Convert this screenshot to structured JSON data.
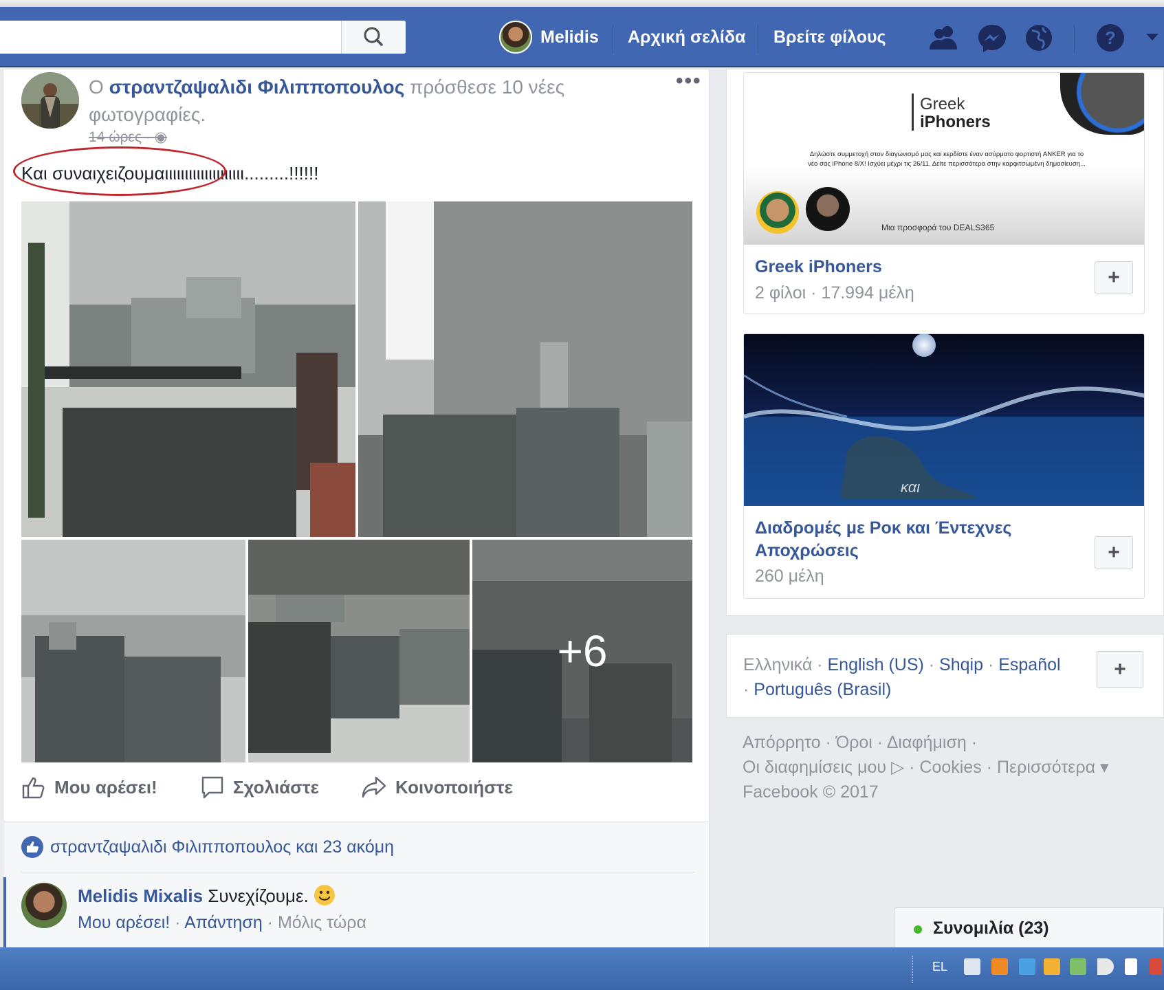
{
  "topbar": {
    "search_placeholder": "",
    "user": "Melidis",
    "home": "Αρχική σελίδα",
    "find_friends": "Βρείτε φίλους"
  },
  "post": {
    "author_prefix": "Ο ",
    "author": "στραντζαψαλιδι Φιλιπποπουλος",
    "action": " πρόσθεσε 10 νέες φωτογραφίες.",
    "meta": "14 ώρες · ",
    "more": "•••",
    "text": "Και συναιχειζουμαιιιιιιιιιιιιιιιιιιιι.........!!!!!!",
    "more_photos": "+6",
    "like": "Μου αρέσει!",
    "comment": "Σχολιάστε",
    "share": "Κοινοποιήστε",
    "likes_line": "στραντζαψαλιδι Φιλιπποπουλος και 23 ακόμη",
    "commenter": "Melidis Mixalis",
    "comment_text": " Συνεχίζουμε. ",
    "comment_like": "Μου αρέσει!",
    "comment_reply": "Απάντηση",
    "comment_time": " · Μόλις τώρα"
  },
  "groups": [
    {
      "name": "Greek iPhoners",
      "members": "2 φίλοι · 17.994 μέλη",
      "banner_title1": "Greek",
      "banner_title2": "iPhoners",
      "banner_text": "Δηλώστε συμμετοχή στον διαγωνισμό μας και κερδίστε έναν ασύρματο φορτιστή ANKER για το νέο σας iPhone 8/X! Ισχύει μέχρι τις 26/11. Δείτε περισσότερα στην καρφιτσωμένη δημοσίευση...",
      "banner_footer": "Μια προσφορά του DEALS365"
    },
    {
      "name": "Διαδρομές με Ροκ και Έντεχνες Αποχρώσεις",
      "members": "260 μέλη",
      "banner_word": "και"
    }
  ],
  "languages": {
    "current": "Ελληνικά",
    "others": [
      "English (US)",
      "Shqip",
      "Español",
      "Português (Brasil)"
    ]
  },
  "footer": {
    "links1": "Απόρρητο · Όροι · Διαφήμιση ·",
    "links2": "Οι διαφημίσεις μου ▷ · Cookies · Περισσότερα ▾",
    "copyright": "Facebook © 2017"
  },
  "chat": {
    "label": "Συνομιλία (23)"
  },
  "taskbar": {
    "lang": "EL"
  },
  "colors": {
    "brand": "#4267b2",
    "link": "#365899",
    "highlight": "#c0262d",
    "online": "#42b72a"
  }
}
